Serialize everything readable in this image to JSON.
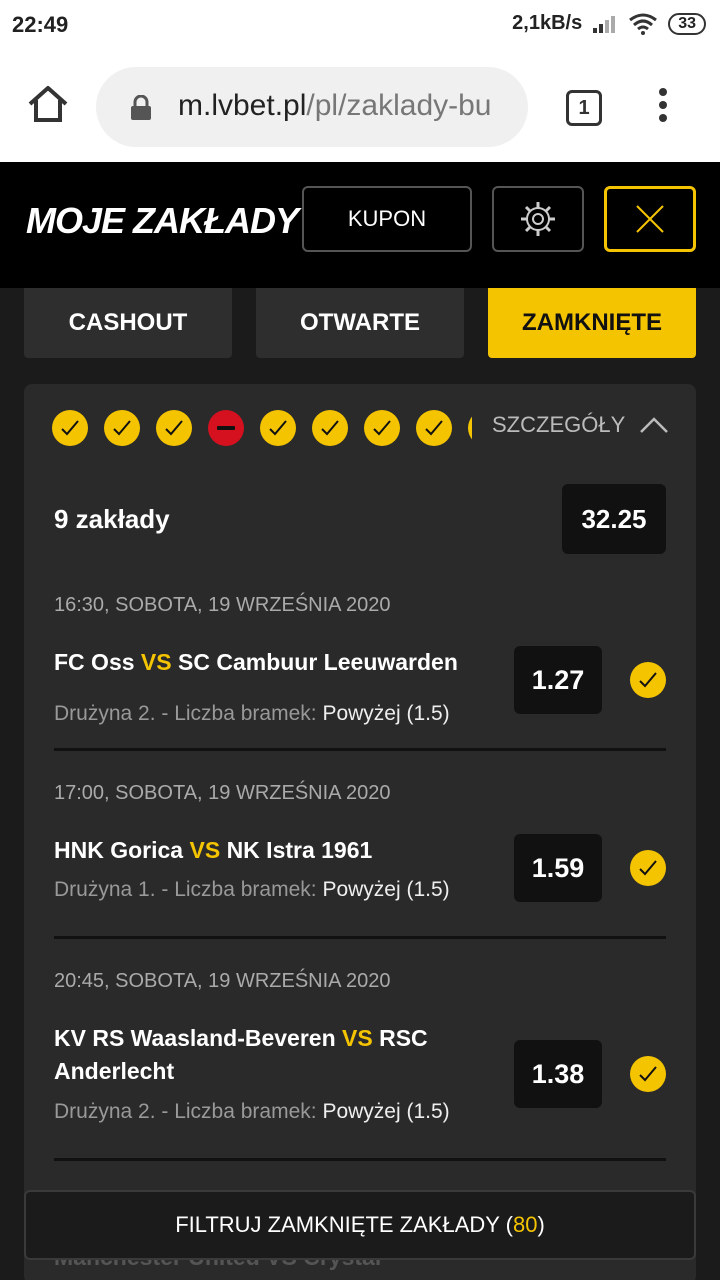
{
  "status": {
    "time": "22:49",
    "net_speed": "2,1kB/s",
    "battery": "33"
  },
  "browser": {
    "url_host": "m.lvbet.pl",
    "url_path": "/pl/zaklady-bu",
    "tab_count": "1"
  },
  "header": {
    "logo": "MOJE ZAKŁADY",
    "kupon": "KUPON",
    "accent": "#f5c400"
  },
  "tabs": [
    {
      "label": "CASHOUT",
      "active": false
    },
    {
      "label": "OTWARTE",
      "active": false
    },
    {
      "label": "ZAMKNIĘTE",
      "active": true
    }
  ],
  "bet": {
    "details_label": "SZCZEGÓŁY",
    "count_label": "9 zakłady",
    "total_odds": "32.25",
    "results": [
      "win",
      "win",
      "win",
      "lost",
      "win",
      "win",
      "win",
      "win",
      "win"
    ],
    "events": [
      {
        "date": "16:30, SOBOTA, 19 WRZEŚNIA 2020",
        "home": "FC Oss",
        "vs": "VS",
        "away": "SC Cambuur Leeuwarden",
        "market": "Drużyna 2. - Liczba bramek: ",
        "pick": "Powyżej (1.5)",
        "odds": "1.27"
      },
      {
        "date": "17:00, SOBOTA, 19 WRZEŚNIA 2020",
        "home": "HNK Gorica",
        "vs": "VS",
        "away": "NK Istra 1961",
        "market": "Drużyna 1. - Liczba bramek: ",
        "pick": "Powyżej (1.5)",
        "odds": "1.59"
      },
      {
        "date": "20:45, SOBOTA, 19 WRZEŚNIA 2020",
        "home": "KV RS Waasland-Beveren",
        "vs": "VS",
        "away": "RSC Anderlecht",
        "market": "Drużyna 2. - Liczba bramek: ",
        "pick": "Powyżej (1.5)",
        "odds": "1.38"
      }
    ],
    "next_event_peek": "Manchester United VS Crystal"
  },
  "filter": {
    "label": "FILTRUJ ZAMKNIĘTE ZAKŁADY (",
    "count": "80",
    "close": ")"
  }
}
